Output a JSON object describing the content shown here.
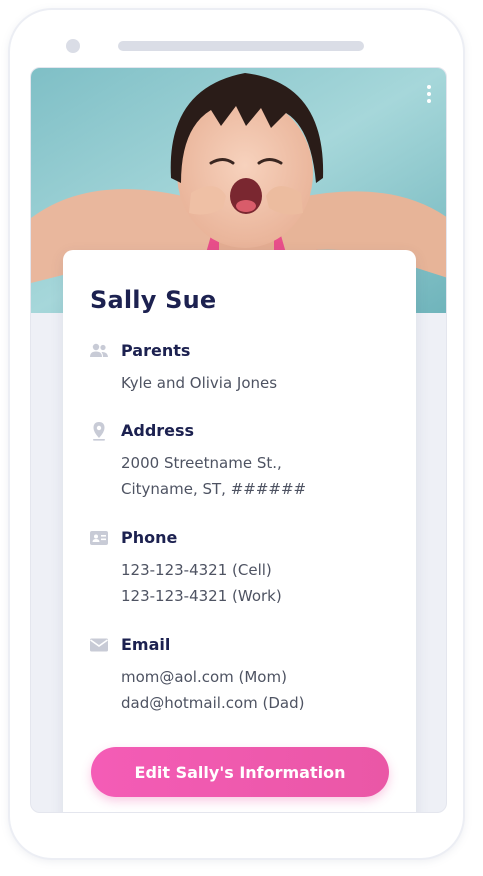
{
  "profile": {
    "name": "Sally Sue",
    "photo_alt": "child-photo"
  },
  "sections": {
    "parents": {
      "icon": "people-icon",
      "title": "Parents",
      "lines": [
        "Kyle and Olivia Jones"
      ]
    },
    "address": {
      "icon": "location-pin-icon",
      "title": "Address",
      "lines": [
        "2000 Streetname St.,",
        "Cityname, ST, ######"
      ]
    },
    "phone": {
      "icon": "contact-card-icon",
      "title": "Phone",
      "lines": [
        "123-123-4321 (Cell)",
        "123-123-4321 (Work)"
      ]
    },
    "email": {
      "icon": "mail-icon",
      "title": "Email",
      "lines": [
        "mom@aol.com (Mom)",
        "dad@hotmail.com (Dad)"
      ]
    }
  },
  "actions": {
    "edit_label": "Edit Sally's Information",
    "menu_icon": "kebab-menu-icon"
  },
  "colors": {
    "heading": "#1c2150",
    "body_text": "#4e5362",
    "icon_gray": "#c8cbd6",
    "button_gradient_start": "#f45cb6",
    "button_gradient_end": "#ea57a6",
    "photo_bg": "#8ec8cc"
  }
}
